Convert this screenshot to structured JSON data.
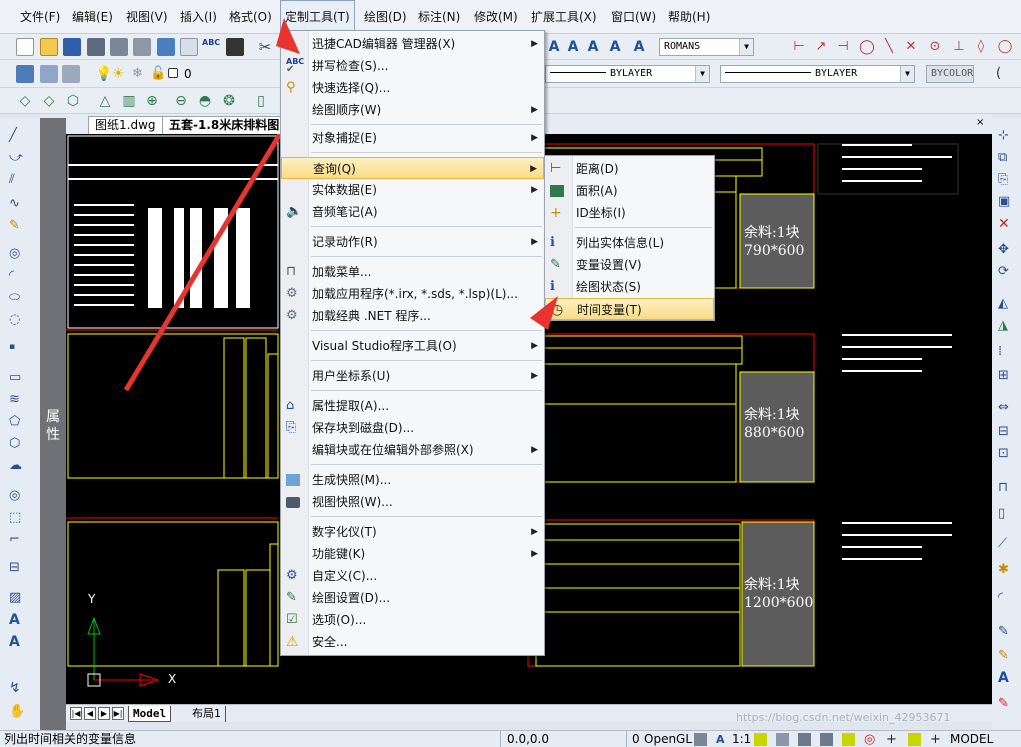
{
  "menubar": [
    {
      "label": "文件(F)"
    },
    {
      "label": "编辑(E)"
    },
    {
      "label": "视图(V)"
    },
    {
      "label": "插入(I)"
    },
    {
      "label": "格式(O)"
    },
    {
      "label": "定制工具(T)"
    },
    {
      "label": "绘图(D)"
    },
    {
      "label": "标注(N)"
    },
    {
      "label": "修改(M)"
    },
    {
      "label": "扩展工具(X)"
    },
    {
      "label": "窗口(W)"
    },
    {
      "label": "帮助(H)"
    }
  ],
  "toolbar": {
    "font_combo": "ROMANS",
    "layer_value": "0",
    "linetype_combo": "BYLAYER",
    "lineweight_combo": "BYLAYER",
    "color_combo": "BYCOLOR"
  },
  "properties_panel_label": "属性",
  "doc_tabs": [
    {
      "label": "图纸1.dwg"
    },
    {
      "label": "五套-1.8米床排料图"
    }
  ],
  "canvas": {
    "remnant_labels": [
      {
        "line1": "余料:1块",
        "line2": "790*600"
      },
      {
        "line1": "余料:1块",
        "line2": "880*600"
      },
      {
        "line1": "余料:1块",
        "line2": "1200*600"
      }
    ],
    "axis_y": "Y",
    "axis_x": "X"
  },
  "layout_tabs": [
    {
      "label": "Model"
    },
    {
      "label": "布局1"
    }
  ],
  "dropdown_tools": {
    "items": [
      {
        "label": "迅捷CAD编辑器 管理器(X)",
        "submenu": true,
        "icon": ""
      },
      {
        "label": "拼写检查(S)...",
        "submenu": false,
        "icon": "spellcheck-icon"
      },
      {
        "label": "快速选择(Q)...",
        "submenu": false,
        "icon": "quick-select-icon"
      },
      {
        "label": "绘图顺序(W)",
        "submenu": true,
        "icon": ""
      },
      {
        "label": "对象捕捉(E)",
        "submenu": true,
        "icon": ""
      },
      {
        "label": "查询(Q)",
        "submenu": true,
        "icon": "",
        "highlighted": true
      },
      {
        "label": "实体数据(E)",
        "submenu": true,
        "icon": ""
      },
      {
        "label": "音频笔记(A)",
        "submenu": false,
        "icon": "audio-note-icon"
      },
      {
        "label": "记录动作(R)",
        "submenu": true,
        "icon": ""
      },
      {
        "label": "加载菜单...",
        "submenu": false,
        "icon": "load-menu-icon"
      },
      {
        "label": "加载应用程序(*.irx, *.sds, *.lsp)(L)...",
        "submenu": false,
        "icon": "load-app-icon"
      },
      {
        "label": "加载经典 .NET 程序...",
        "submenu": false,
        "icon": "load-net-icon"
      },
      {
        "label": "Visual Studio程序工具(O)",
        "submenu": true,
        "icon": ""
      },
      {
        "label": "用户坐标系(U)",
        "submenu": true,
        "icon": ""
      },
      {
        "label": "属性提取(A)...",
        "submenu": false,
        "icon": "attribute-extract-icon"
      },
      {
        "label": "保存块到磁盘(D)...",
        "submenu": false,
        "icon": "save-block-icon"
      },
      {
        "label": "编辑块或在位编辑外部参照(X)",
        "submenu": true,
        "icon": ""
      },
      {
        "label": "生成快照(M)...",
        "submenu": false,
        "icon": "snapshot-icon"
      },
      {
        "label": "视图快照(W)...",
        "submenu": false,
        "icon": "camera-icon"
      },
      {
        "label": "数字化仪(T)",
        "submenu": true,
        "icon": ""
      },
      {
        "label": "功能键(K)",
        "submenu": true,
        "icon": ""
      },
      {
        "label": "自定义(C)...",
        "submenu": false,
        "icon": "customize-icon"
      },
      {
        "label": "绘图设置(D)...",
        "submenu": false,
        "icon": "drawing-settings-icon"
      },
      {
        "label": "选项(O)...",
        "submenu": false,
        "icon": "options-icon"
      },
      {
        "label": "安全...",
        "submenu": false,
        "icon": "security-warning-icon"
      }
    ]
  },
  "dropdown_query": {
    "items": [
      {
        "label": "距离(D)",
        "icon": "distance-icon"
      },
      {
        "label": "面积(A)",
        "icon": "area-icon"
      },
      {
        "label": "ID坐标(I)",
        "icon": "id-coordinate-icon"
      },
      {
        "label": "列出实体信息(L)",
        "icon": "list-entity-icon"
      },
      {
        "label": "变量设置(V)",
        "icon": "variable-settings-icon"
      },
      {
        "label": "绘图状态(S)",
        "icon": "drawing-status-icon"
      },
      {
        "label": "时间变量(T)",
        "icon": "clock-icon",
        "highlighted": true
      }
    ]
  },
  "statusbar": {
    "message": "列出时间相关的变量信息",
    "coordinates": "0.0,0.0",
    "zero_value": "0",
    "render_mode": "OpenGL",
    "scale": "1:1",
    "space": "MODEL",
    "watermark": "https://blog.csdn.net/weixin_42953671"
  },
  "colors": {
    "highlight": "#f8dc84",
    "canvas_bg": "#000000",
    "arrow": "#e8332f",
    "drawing_yellow": "#ffff00",
    "drawing_red": "#ff0000"
  }
}
